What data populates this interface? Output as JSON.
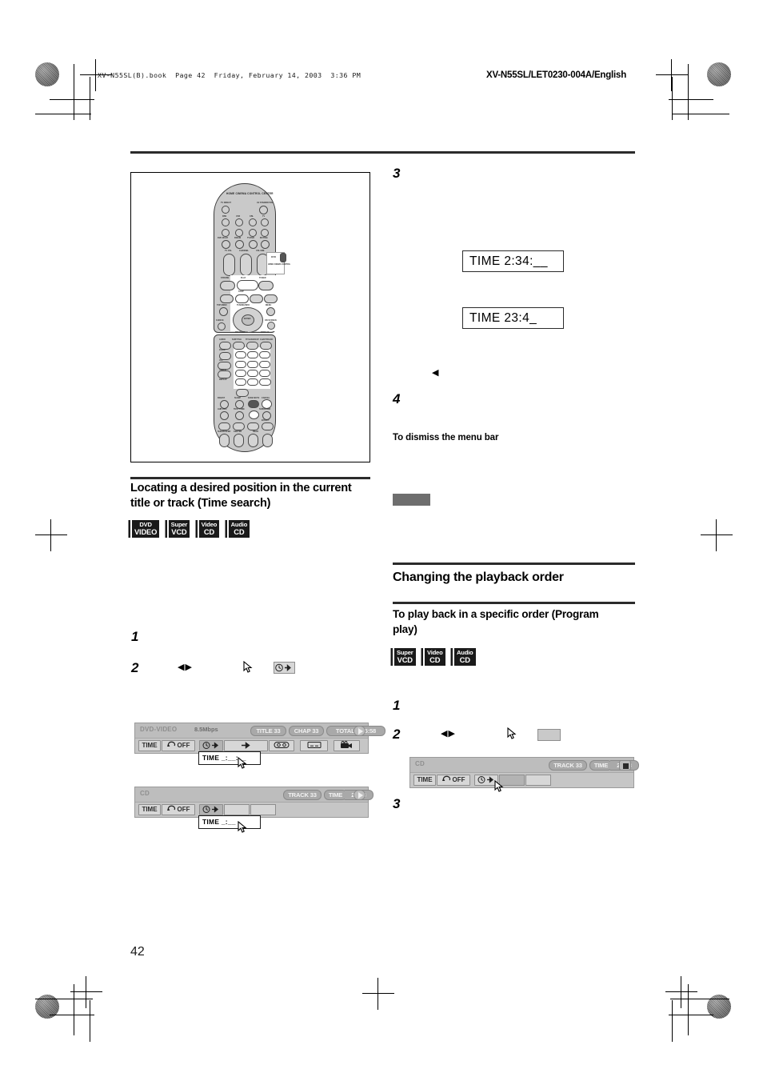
{
  "page": {
    "number": "42",
    "book_line": "XV-N55SL(B).book  Page 42  Friday, February 14, 2003  3:36 PM",
    "doc_code": "XV-N55SL/LET0230-004A/English"
  },
  "left_column": {
    "figure": {
      "name": "remote-control-illustration",
      "remote_title": "HOME CINEMA CONTROL CENTER",
      "labels": {
        "tv_direct": "TV DIRECT",
        "av_standby": "AV STANDBY/ON",
        "row_dbs": "DBS",
        "row_vcr": "VCR",
        "row_cbl": "CBL",
        "row_tv": "TV",
        "dvd_multi": "DVD MULTI",
        "fm_am": "FM/AM",
        "tv_vcr_ch": "TV/DVD",
        "muting": "MUTING",
        "tv_vol": "TV VOL",
        "channel": "CHANNEL",
        "volume": "VOLUME",
        "dvd": "DVD",
        "home_cinema": "HOME CINEMA CONTROL",
        "strobe": "STROBE",
        "play": "PLAY",
        "tuner": "TUNER",
        "stop": "STOP",
        "top_menu": "TOP MENU",
        "tuning_info": "TUNING/INFO",
        "menu": "MENU",
        "enter": "ENTER",
        "choice": "CHOICE",
        "pty_search": "PTY SEARCH",
        "display": "DISPLAY",
        "on_screen": "ON SCREEN",
        "audio": "AUDIO",
        "subtitle": "SUBTITLE",
        "zoom": "ZOOM",
        "angle": "ANGLE",
        "repeat": "REPEAT",
        "vfp": "VFP",
        "title_group": "TITLE/GROUP",
        "chap_track": "CHAP/TRACK",
        "digest": "DIGEST",
        "sleep": "SLEEP",
        "fade_mute": "FADE MUTE",
        "cancel": "CANCEL",
        "ahb_pro": "AHB PRO",
        "test_tone": "TEST TONE",
        "surround": "SURROUND",
        "effect": "EFFECT",
        "enter_k": "ENTER",
        "subwoofer": "SUBWOOFER",
        "center": "CENTER",
        "rear": "REAR"
      }
    },
    "section": {
      "title": "Locating a desired position in the current title or track (Time search)",
      "badges": [
        {
          "l1": "DVD",
          "l2": "VIDEO"
        },
        {
          "l1": "Super",
          "l2": "VCD"
        },
        {
          "l1": "Video",
          "l2": "CD"
        },
        {
          "l1": "Audio",
          "l2": "CD"
        }
      ]
    },
    "steps": [
      {
        "num": "1",
        "text": ""
      },
      {
        "num": "2",
        "text": ""
      }
    ],
    "osd_dvd": {
      "disc_label": "DVD-VIDEO",
      "bitrate": "8.5Mbps",
      "chips": [
        "TITLE 33",
        "CHAP 33",
        "TOTAL 1:25:58"
      ],
      "cells": [
        "TIME",
        "OFF"
      ],
      "time_popup": "TIME   _:__:__"
    },
    "osd_cd": {
      "disc_label": "CD",
      "chips": [
        "TRACK 33",
        "TIME",
        "25:58"
      ],
      "cells": [
        "TIME",
        "OFF"
      ],
      "time_popup": "TIME      _:__"
    }
  },
  "right_column": {
    "steps": [
      {
        "num": "3",
        "text": ""
      },
      {
        "num": "4",
        "text": ""
      }
    ],
    "time_display_1": "TIME  2:34:__",
    "time_display_2": "TIME     23:4_",
    "dismiss_note": "To dismiss the menu bar",
    "section": {
      "title": "Changing the playback order",
      "subtitle": "To play back in a specific order (Program play)",
      "badges": [
        {
          "l1": "Super",
          "l2": "VCD"
        },
        {
          "l1": "Video",
          "l2": "CD"
        },
        {
          "l1": "Audio",
          "l2": "CD"
        }
      ]
    },
    "program_steps": [
      {
        "num": "1",
        "text": ""
      },
      {
        "num": "2",
        "text": ""
      },
      {
        "num": "3",
        "text": ""
      }
    ],
    "osd_cd_program": {
      "disc_label": "CD",
      "chips": [
        "TRACK 33",
        "TIME",
        "25:58"
      ],
      "cells": [
        "TIME",
        "OFF"
      ]
    }
  },
  "colors": {
    "rule": "#2b2b2b",
    "badge_bg": "#1a1a1a",
    "osd_bg": "#c6c6c6",
    "gray_bar": "#6e6e6e"
  }
}
